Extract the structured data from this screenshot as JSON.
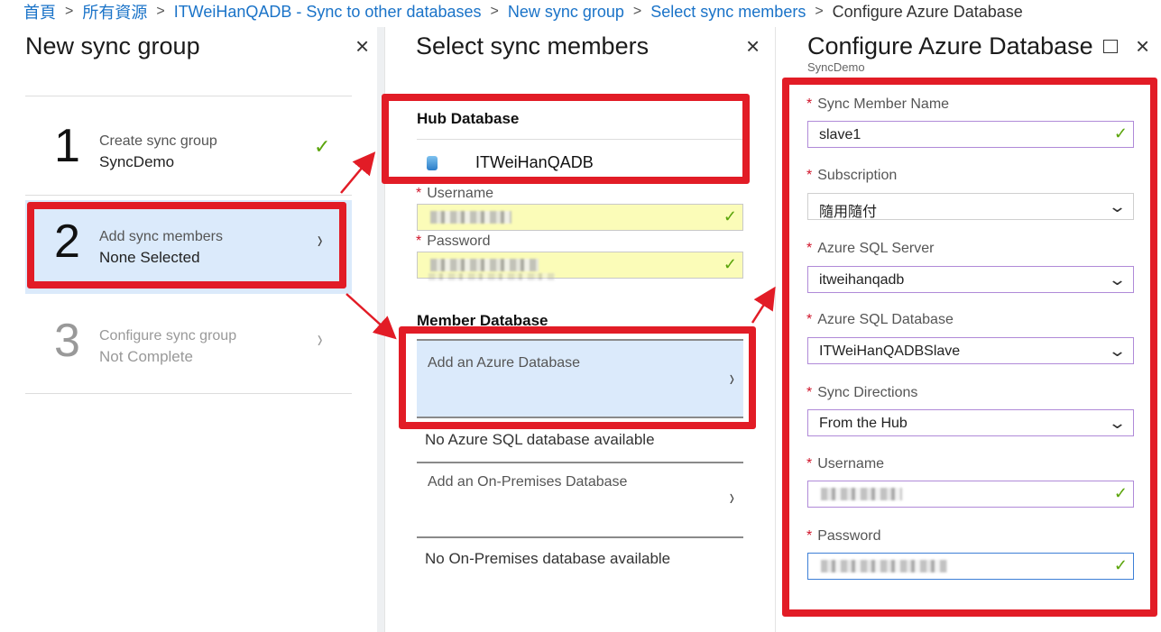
{
  "breadcrumb": {
    "items": [
      "首頁",
      "所有資源",
      "ITWeiHanQADB - Sync to other databases",
      "New sync group",
      "Select sync members"
    ],
    "current": "Configure Azure Database"
  },
  "panel_new_sync_group": {
    "title": "New sync group",
    "steps": [
      {
        "number": "1",
        "title": "Create sync group",
        "subtitle": "SyncDemo",
        "status": "complete"
      },
      {
        "number": "2",
        "title": "Add sync members",
        "subtitle": "None Selected",
        "status": "active"
      },
      {
        "number": "3",
        "title": "Configure sync group",
        "subtitle": "Not Complete",
        "status": "disabled"
      }
    ]
  },
  "panel_select_members": {
    "title": "Select sync members",
    "hub_label": "Hub Database",
    "hub_db_name": "ITWeiHanQADB",
    "username_label": "Username",
    "password_label": "Password",
    "member_label": "Member Database",
    "add_azure_label": "Add an Azure Database",
    "no_azure_text": "No Azure SQL database available",
    "add_onprem_label": "Add an On-Premises Database",
    "no_onprem_text": "No On-Premises database available"
  },
  "panel_configure": {
    "title": "Configure Azure Database",
    "subtitle": "SyncDemo",
    "fields": {
      "sync_member_name": {
        "label": "Sync Member Name",
        "value": "slave1"
      },
      "subscription": {
        "label": "Subscription",
        "value": "隨用隨付"
      },
      "sql_server": {
        "label": "Azure SQL Server",
        "value": "itweihanqadb"
      },
      "sql_database": {
        "label": "Azure SQL Database",
        "value": "ITWeiHanQADBSlave"
      },
      "sync_directions": {
        "label": "Sync Directions",
        "value": "From the Hub"
      },
      "username": {
        "label": "Username"
      },
      "password": {
        "label": "Password"
      }
    }
  },
  "icons": {
    "required_marker": "*",
    "check": "✓",
    "chevron_right": "›",
    "chevron_down": "⌄",
    "close": "×"
  },
  "colors": {
    "highlight_red": "#e21c26",
    "link_blue": "#1a73c8",
    "active_bg": "#dbeafb",
    "check_green": "#5aa40a"
  }
}
